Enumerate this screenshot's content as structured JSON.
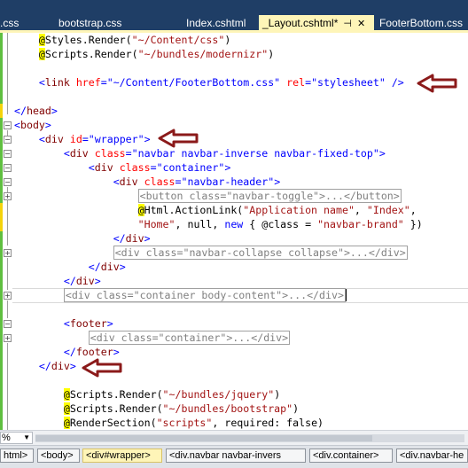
{
  "tabs": [
    {
      "label": ".css"
    },
    {
      "label": "bootstrap.css"
    },
    {
      "label": "Index.cshtml"
    },
    {
      "label": "_Layout.cshtml*",
      "active": true
    },
    {
      "label": "FooterBottom.css"
    }
  ],
  "editor": {
    "lines": {
      "l1": {
        "razor": "@",
        "name": "Styles",
        "mid": ".Render(",
        "str": "\"~/Content/css\"",
        "end": ")"
      },
      "l2": {
        "razor": "@",
        "name": "Scripts",
        "mid": ".Render(",
        "str": "\"~/bundles/modernizr\"",
        "end": ")"
      },
      "l4": {
        "open": "<",
        "tag": "link",
        "a1": "href",
        "v1": "=\"~/Content/FooterBottom.css\"",
        "a2": "rel",
        "v2": "=\"stylesheet\"",
        "close": " />"
      },
      "l6": {
        "open": "</",
        "tag": "head",
        "close": ">"
      },
      "l7": {
        "open": "<",
        "tag": "body",
        "close": ">"
      },
      "l8": {
        "open": "<",
        "tag": "div",
        "a1": "id",
        "v1": "=\"wrapper\"",
        "close": ">"
      },
      "l9": {
        "open": "<",
        "tag": "div",
        "a1": "class",
        "v1": "=\"navbar navbar-inverse navbar-fixed-top\"",
        "close": ">"
      },
      "l10": {
        "open": "<",
        "tag": "div",
        "a1": "class",
        "v1": "=\"container\"",
        "close": ">"
      },
      "l11": {
        "open": "<",
        "tag": "div",
        "a1": "class",
        "v1": "=\"navbar-header\"",
        "close": ">"
      },
      "l12": {
        "collapsed": "<button class=\"navbar-toggle\">...</button>"
      },
      "l13": {
        "razor": "@",
        "name": "Html",
        "mid": ".ActionLink(",
        "s1": "\"Application name\"",
        "c1": ", ",
        "s2": "\"Index\"",
        "c2": ","
      },
      "l14": {
        "s1": "\"Home\"",
        "c1": ", null, ",
        "kw": "new",
        "c2": " { @class = ",
        "s2": "\"navbar-brand\"",
        "c3": " })"
      },
      "l15": {
        "open": "</",
        "tag": "div",
        "close": ">"
      },
      "l16": {
        "collapsed": "<div class=\"navbar-collapse collapse\">...</div>"
      },
      "l17": {
        "open": "</",
        "tag": "div",
        "close": ">"
      },
      "l18": {
        "open": "</",
        "tag": "div",
        "close": ">"
      },
      "l19": {
        "collapsed": "<div class=\"container body-content\">...</div>"
      },
      "l21": {
        "open": "<",
        "tag": "footer",
        "close": ">"
      },
      "l22": {
        "collapsed": "<div class=\"container\">...</div>"
      },
      "l23": {
        "open": "</",
        "tag": "footer",
        "close": ">"
      },
      "l24": {
        "open": "</",
        "tag": "div",
        "close": ">"
      },
      "l26": {
        "razor": "@",
        "name": "Scripts",
        "mid": ".Render(",
        "str": "\"~/bundles/jquery\"",
        "end": ")"
      },
      "l27": {
        "razor": "@",
        "name": "Scripts",
        "mid": ".Render(",
        "str": "\"~/bundles/bootstrap\"",
        "end": ")"
      },
      "l28": {
        "razor": "@",
        "name": "RenderSection(",
        "str": "\"scripts\"",
        "end": ", required: false)"
      }
    }
  },
  "zoom": {
    "value": "%"
  },
  "breadcrumbs": [
    {
      "label": "html>"
    },
    {
      "label": "<body>"
    },
    {
      "label": "<div#wrapper>",
      "active": true
    },
    {
      "label": "<div.navbar navbar-invers"
    },
    {
      "label": "<div.container>"
    },
    {
      "label": "<div.navbar-he"
    }
  ],
  "colors": {
    "annotation_arrow": "#8b1a1a",
    "tab_bar": "#1f3e66",
    "active_tab": "#fef5b8"
  }
}
